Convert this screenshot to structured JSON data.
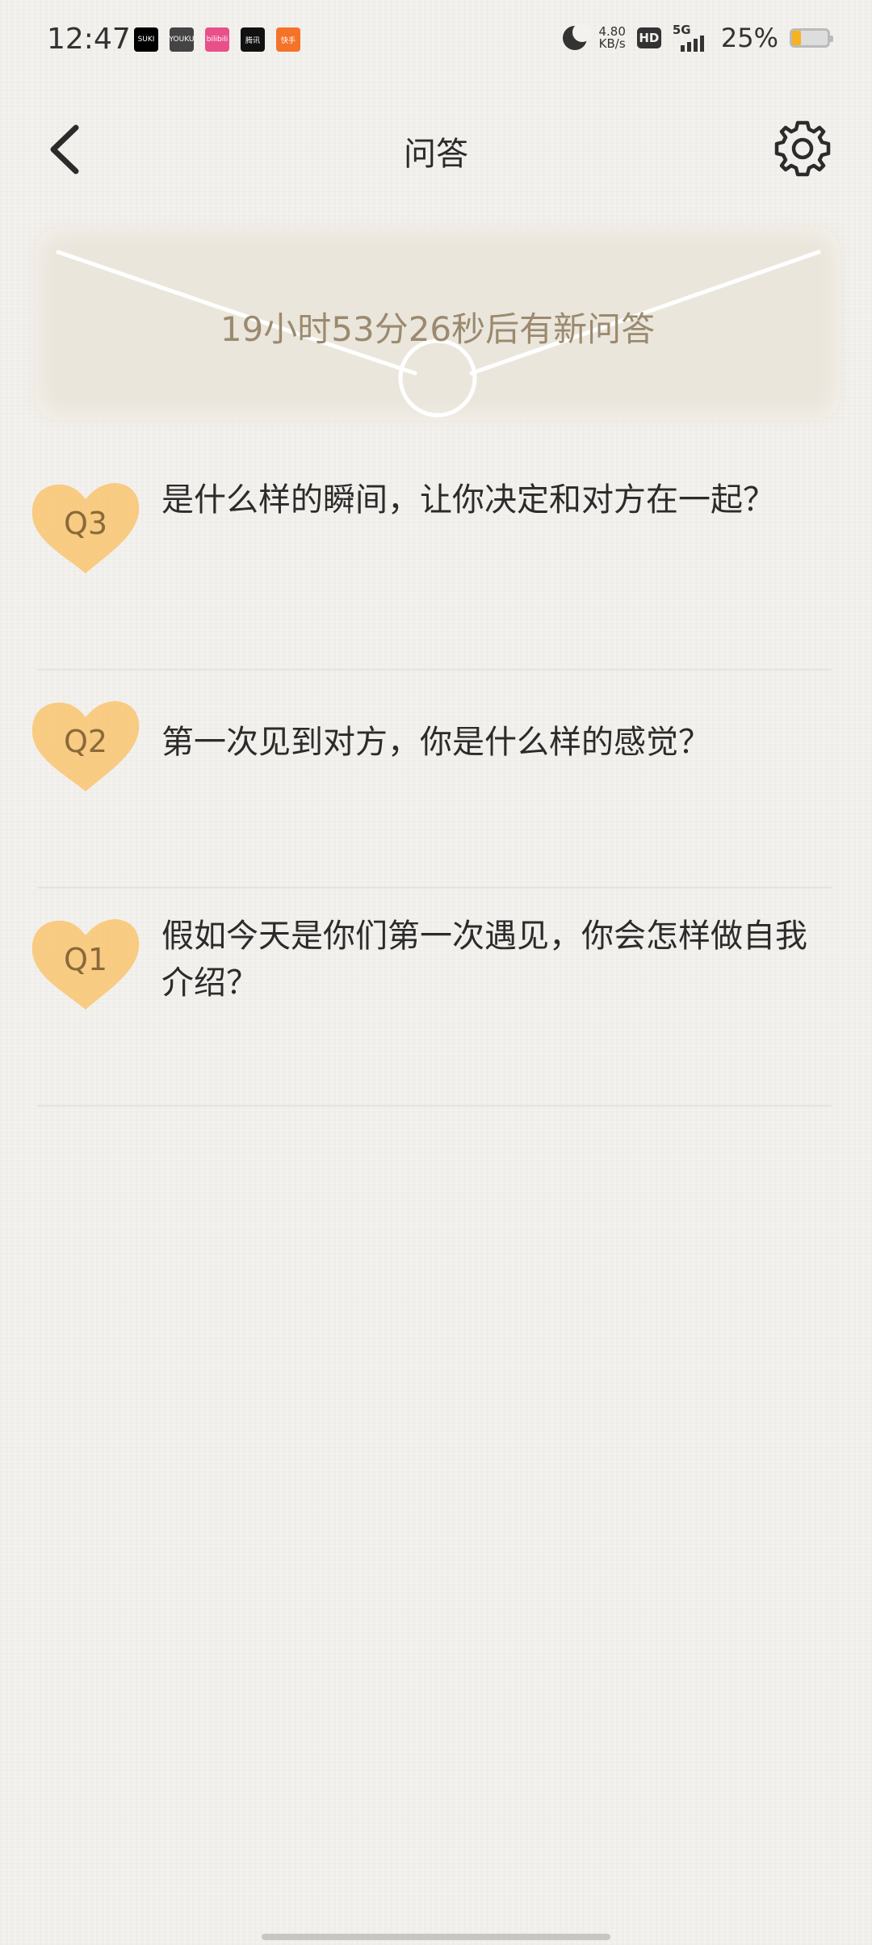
{
  "status_bar": {
    "time": "12:47",
    "apps": [
      {
        "label": "SUKI",
        "color": "#000000"
      },
      {
        "label": "YOUKU",
        "color": "#444444"
      },
      {
        "label": "bilibili",
        "color": "#e8508a"
      },
      {
        "label": "腾讯",
        "color": "#111111"
      },
      {
        "label": "快手",
        "color": "#f57328"
      }
    ],
    "net_speed_value": "4.80",
    "net_speed_unit": "KB/s",
    "hd": "HD",
    "signal": "5G",
    "battery_pct": "25%",
    "battery_level": 0.25
  },
  "nav": {
    "title": "问答"
  },
  "banner": {
    "countdown": "19小时53分26秒后有新问答"
  },
  "questions": [
    {
      "badge": "Q3",
      "text": "是什么样的瞬间，让你决定和对方在一起？"
    },
    {
      "badge": "Q2",
      "text": "第一次见到对方，你是什么样的感觉？"
    },
    {
      "badge": "Q1",
      "text": "假如今天是你们第一次遇见，你会怎样做自我介绍？"
    }
  ],
  "colors": {
    "badge": "#f9c879",
    "countdown": "#9b8a6f"
  }
}
